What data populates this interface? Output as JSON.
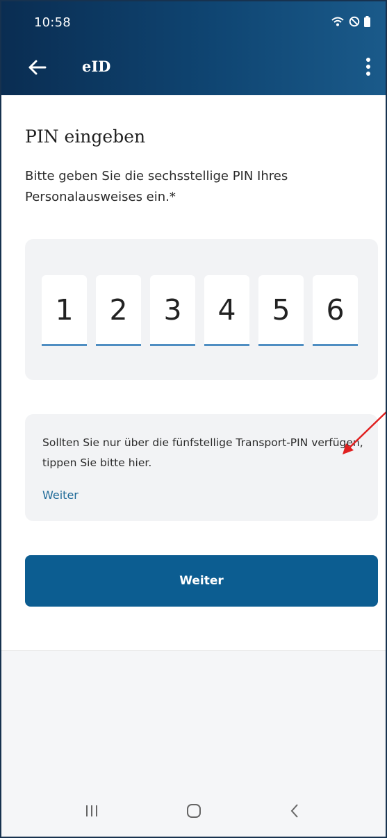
{
  "status_bar": {
    "time": "10:58",
    "icons": [
      "wifi-icon",
      "do-not-disturb-icon",
      "battery-icon"
    ]
  },
  "app_bar": {
    "title": "eID",
    "back_icon": "arrow-left-icon",
    "menu_icon": "more-vertical-icon"
  },
  "main": {
    "title": "PIN eingeben",
    "instruction": "Bitte geben Sie die sechsstellige PIN Ihres Personalausweises ein.*",
    "pin_digits": [
      "1",
      "2",
      "3",
      "4",
      "5",
      "6"
    ],
    "transport_hint": "Sollten Sie nur über die fünfstellige Transport-PIN verfügen, tippen Sie bitte hier.",
    "transport_link": "Weiter",
    "submit_label": "Weiter"
  },
  "nav_bar": {
    "buttons": [
      "recent-apps-icon",
      "home-icon",
      "back-icon"
    ]
  },
  "colors": {
    "header_start": "#0a2d52",
    "header_end": "#1a5a8a",
    "primary": "#0c5d91",
    "link": "#1f6a98",
    "pin_underline": "#4f8ec2",
    "annotation": "#e02020"
  }
}
